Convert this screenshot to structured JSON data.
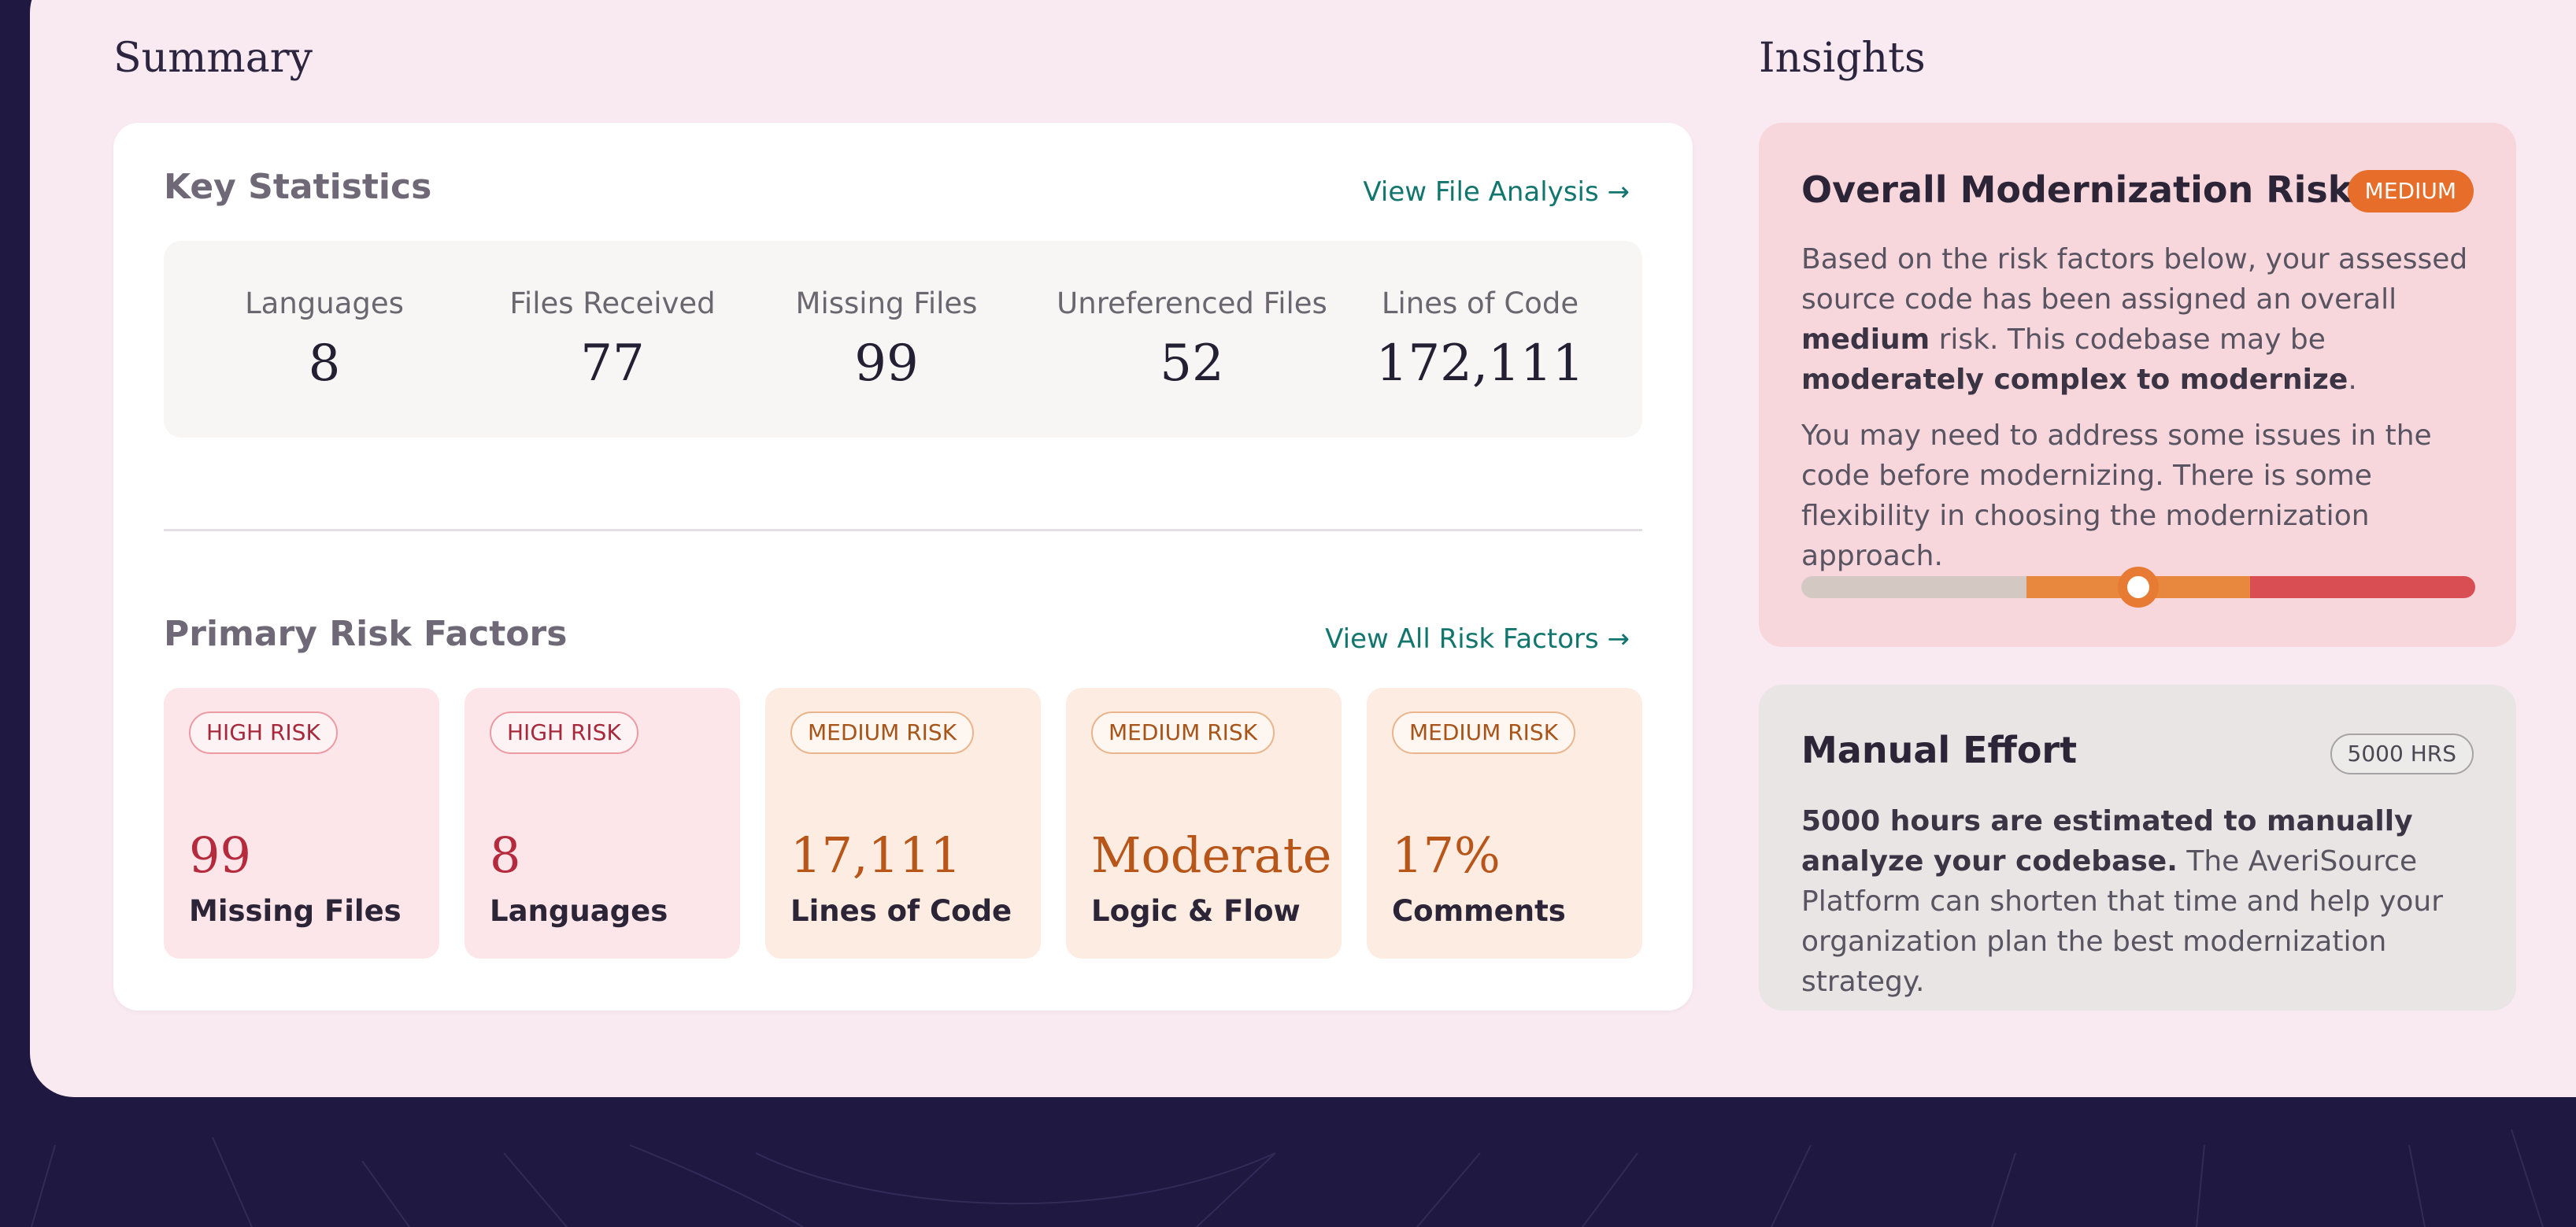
{
  "summary": {
    "title": "Summary",
    "key_statistics": {
      "heading": "Key Statistics",
      "link": "View File Analysis →",
      "stats": [
        {
          "label": "Languages",
          "value": "8"
        },
        {
          "label": "Files Received",
          "value": "77"
        },
        {
          "label": "Missing Files",
          "value": "99"
        },
        {
          "label": "Unreferenced Files",
          "value": "52"
        },
        {
          "label": "Lines of Code",
          "value": "172,111"
        }
      ]
    },
    "risk_factors": {
      "heading": "Primary Risk Factors",
      "link": "View All Risk Factors →",
      "cards": [
        {
          "badge": "HIGH RISK",
          "value": "99",
          "label": "Missing Files"
        },
        {
          "badge": "HIGH RISK",
          "value": "8",
          "label": "Languages"
        },
        {
          "badge": "MEDIUM RISK",
          "value": "17,111",
          "label": "Lines of Code"
        },
        {
          "badge": "MEDIUM RISK",
          "value": "Moderate",
          "label": "Logic & Flow"
        },
        {
          "badge": "MEDIUM RISK",
          "value": "17%",
          "label": "Comments"
        }
      ]
    }
  },
  "insights": {
    "title": "Insights",
    "risk": {
      "title": "Overall Modernization Risk",
      "badge": "MEDIUM",
      "p1_a": "Based on the risk factors below, your assessed source code has been assigned an overall ",
      "p1_b": "medium",
      "p1_c": " risk. This codebase may be ",
      "p1_d": "moderately complex to modernize",
      "p1_e": ".",
      "p2": "You may need to address some issues in the code before modernizing. There is some flexibility in choosing the modernization approach.",
      "level": 0.5
    },
    "effort": {
      "title": "Manual Effort",
      "badge": "5000 HRS",
      "text_bold": "5000 hours are estimated to manually analyze your codebase.",
      "text_rest": " The AveriSource Platform can shorten that time and help your organization plan the best modernization strategy."
    }
  },
  "colors": {
    "page_bg": "#1f1840",
    "panel_bg": "#f9e9f0",
    "link": "#12766f",
    "high_risk": "#b52b3d",
    "medium_risk": "#b8561a",
    "badge_medium": "#e66d2a"
  }
}
